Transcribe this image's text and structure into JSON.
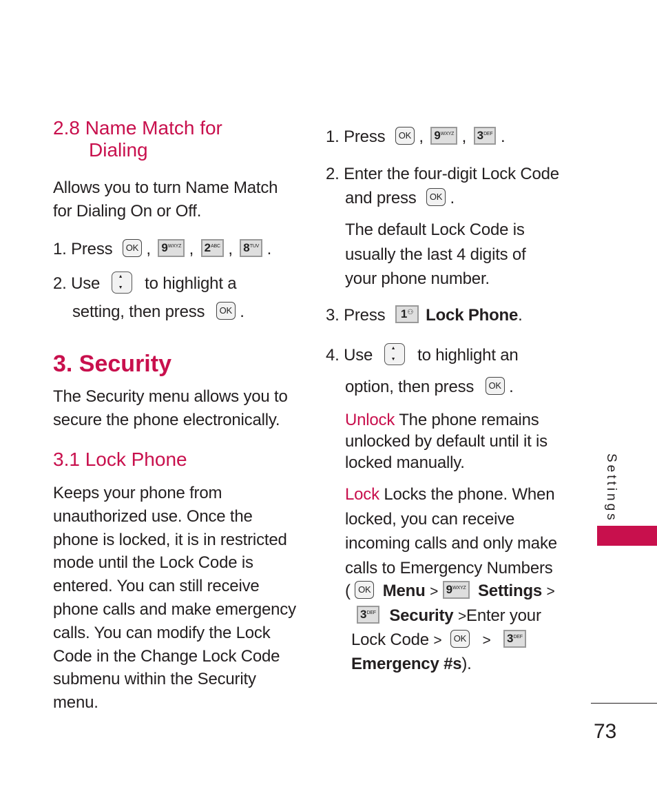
{
  "left": {
    "s28": {
      "title_line1": "2.8 Name Match for",
      "title_line2": "Dialing",
      "desc_line1": "Allows you to turn Name Match",
      "desc_line2": "for Dialing On or Off.",
      "step1_prefix": "1. Press",
      "step2_prefix": "2. Use",
      "step2_mid": "to highlight a",
      "step2_line2": "setting, then press"
    },
    "s3": {
      "title": "3. Security",
      "desc_line1": "The Security menu allows you to",
      "desc_line2": "secure the phone electronically."
    },
    "s31": {
      "title": "3.1 Lock Phone",
      "lines": [
        "Keeps your phone from",
        "unauthorized use. Once the",
        "phone is locked, it is in restricted",
        "mode until the Lock Code is",
        "entered. You can still receive",
        "phone calls and make emergency",
        "calls. You can modify the Lock",
        "Code in the Change Lock Code",
        "submenu within the Security",
        "menu."
      ]
    }
  },
  "right": {
    "step1_prefix": "1. Press",
    "step2_line1": "2. Enter the four-digit Lock Code",
    "step2_line2": "and press",
    "note_lines": [
      "The default Lock Code is",
      "usually the last 4 digits of",
      "your phone number."
    ],
    "step3_prefix": "3. Press",
    "step3_label": "Lock Phone",
    "step4_prefix": "4. Use",
    "step4_mid": "to highlight an",
    "step4_line2": "option, then press",
    "unlock_term": "Unlock",
    "unlock_line1": "The phone remains",
    "unlock_line2": "unlocked by default until it is",
    "unlock_line3": "locked manually.",
    "lock_term": "Lock",
    "lock_line1": "Locks the phone. When",
    "lock_lines": [
      "locked, you can receive",
      "incoming calls and only make",
      "calls to Emergency Numbers"
    ],
    "path": {
      "open": "(",
      "menu": "Menu",
      "settings": "Settings",
      "security": "Security",
      "enter": "Enter your",
      "lock_code": "Lock Code",
      "emergency": "Emergency #s",
      "close": ").",
      "sep": ">"
    }
  },
  "keys": {
    "ok": "OK",
    "k9": {
      "digit": "9",
      "letters": "WXYZ"
    },
    "k2": {
      "digit": "2",
      "letters": "ABC"
    },
    "k8": {
      "digit": "8",
      "letters": "TUV"
    },
    "k3": {
      "digit": "3",
      "letters": "DEF"
    },
    "k1": {
      "digit": "1",
      "letters": "⚇"
    }
  },
  "sidebar": {
    "section": "Settings"
  },
  "footer": {
    "page_number": "73"
  },
  "colors": {
    "accent": "#c8104d",
    "text": "#231f20"
  }
}
